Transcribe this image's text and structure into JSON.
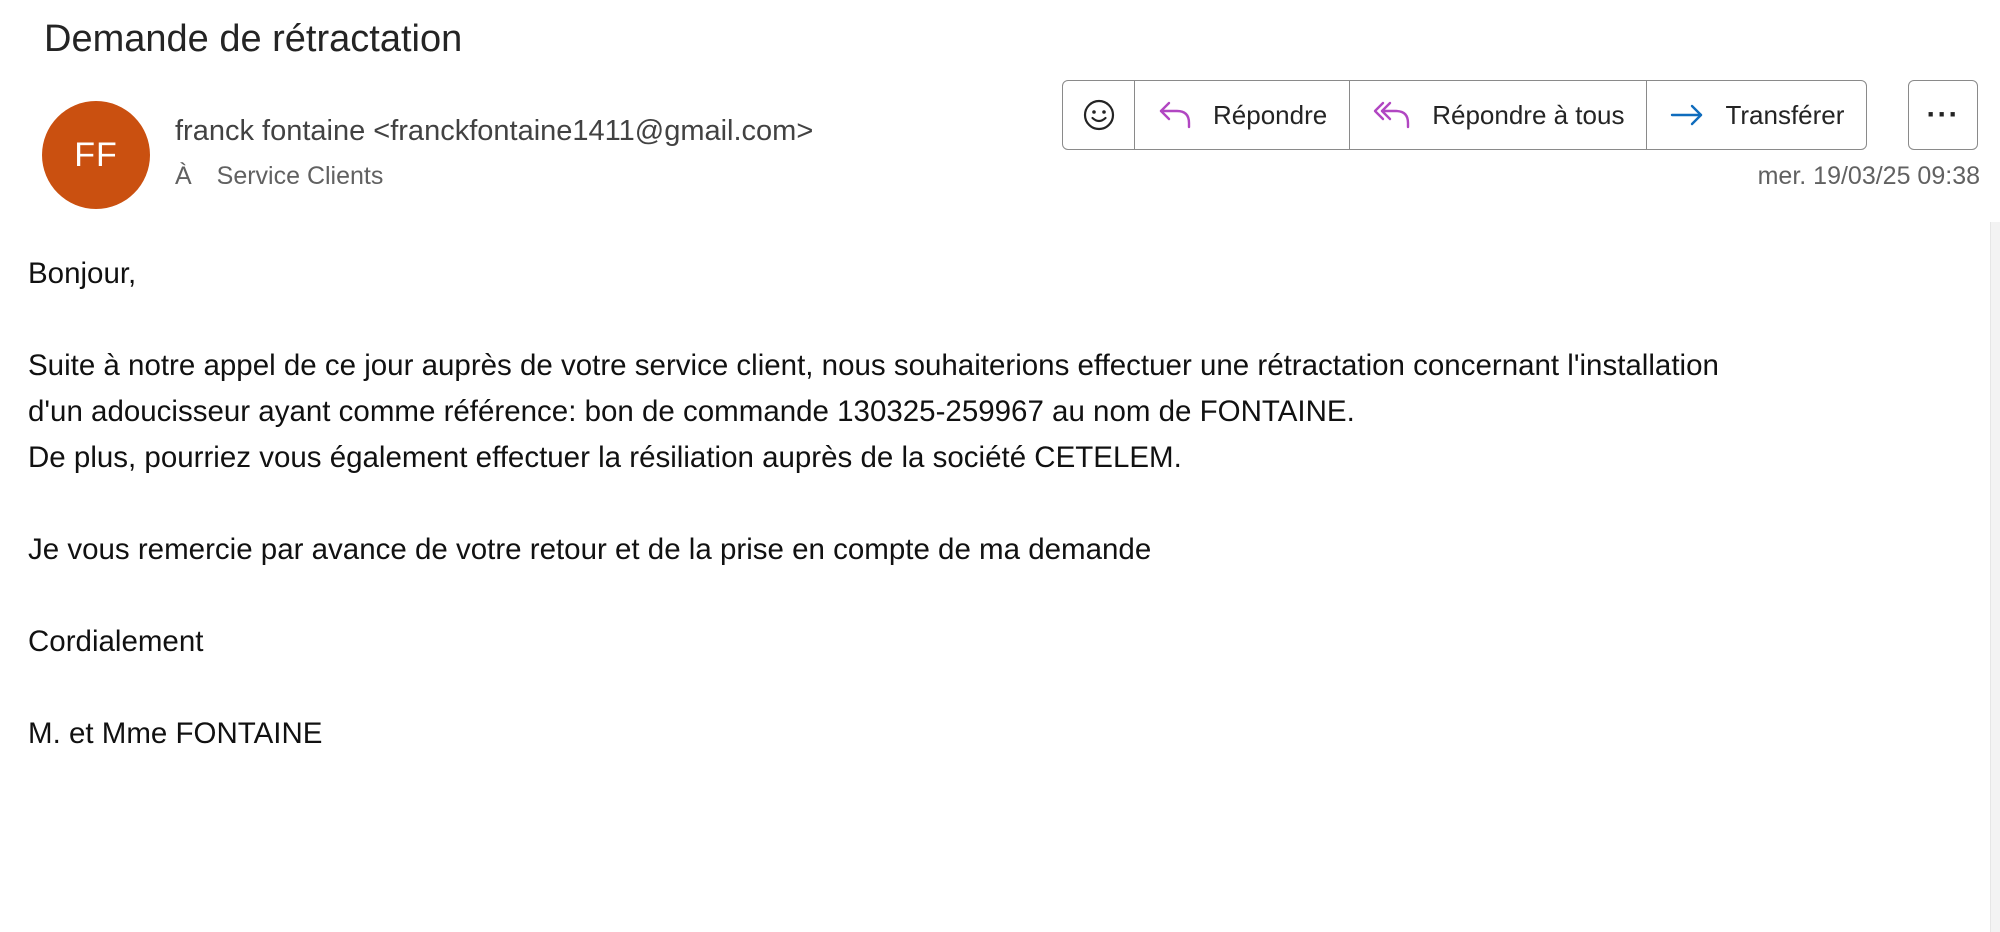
{
  "email": {
    "subject": "Demande de rétractation",
    "avatar_initials": "FF",
    "sender": "franck fontaine <franckfontaine1411@gmail.com>",
    "to_label": "À",
    "to": "Service Clients",
    "timestamp": "mer. 19/03/25 09:38"
  },
  "toolbar": {
    "emoji_icon": "emoji-smile-icon",
    "reply_label": "Répondre",
    "reply_all_label": "Répondre à tous",
    "forward_label": "Transférer",
    "more_label": "···",
    "accent_reply": "#b146c2",
    "accent_forward": "#0f6cbd"
  },
  "body": {
    "greeting": "Bonjour,",
    "para1_line1": "Suite à notre appel de ce jour auprès de votre service client, nous souhaiterions effectuer une rétractation concernant l'installation",
    "para1_line2": "d'un adoucisseur ayant comme référence: bon de commande 130325-259967 au nom de FONTAINE.",
    "para1_line3": "De plus, pourriez vous également effectuer la résiliation auprès de la société CETELEM.",
    "para2": "Je vous remercie par avance de votre retour et de la prise en compte de ma demande",
    "closing": "Cordialement",
    "signature": "M. et Mme FONTAINE"
  },
  "colors": {
    "avatar_bg": "#ca5010",
    "border": "#8a8a8a"
  }
}
